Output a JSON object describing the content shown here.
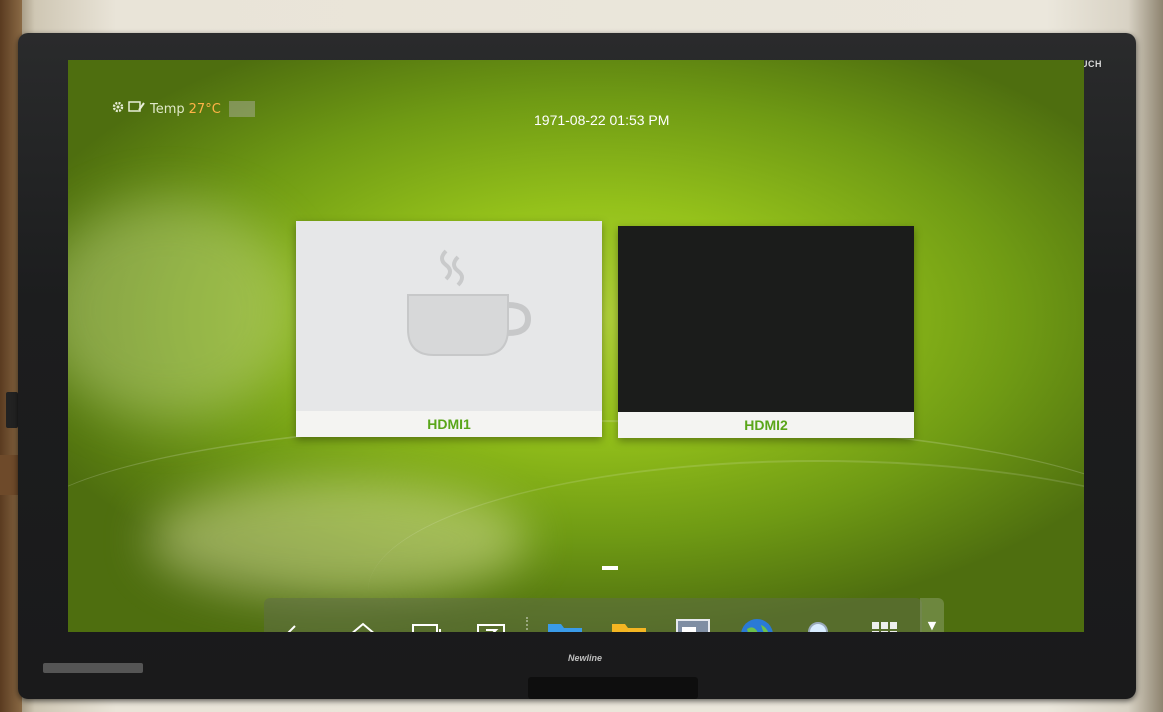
{
  "device": {
    "brand_top": "TRUTOUCH",
    "brand_bottom": "Newline"
  },
  "status_bar": {
    "temp_label": "Temp",
    "temp_value": "27°C"
  },
  "clock": {
    "datetime": "1971-08-22 01:53 PM"
  },
  "sources": [
    {
      "label": "HDMI1",
      "preview": "coffee-cup-idle"
    },
    {
      "label": "HDMI2",
      "preview": "black-signal"
    }
  ],
  "pager": {
    "current_page": 1,
    "total_pages": 1
  },
  "dock": {
    "items": [
      {
        "name": "back",
        "icon": "back-arrow-icon"
      },
      {
        "name": "home",
        "icon": "home-icon"
      },
      {
        "name": "recent-apps",
        "icon": "window-icon"
      },
      {
        "name": "z-note",
        "icon": "z-icon"
      },
      {
        "name": "files",
        "icon": "folder-icon"
      },
      {
        "name": "usb",
        "icon": "usb-folder-icon"
      },
      {
        "name": "settings",
        "icon": "settings-panel-icon"
      },
      {
        "name": "browser",
        "icon": "globe-icon"
      },
      {
        "name": "search",
        "icon": "search-icon"
      },
      {
        "name": "all-apps",
        "icon": "grid-icon"
      }
    ],
    "expand": {
      "icon": "triangle-down-icon"
    }
  },
  "colors": {
    "accent_green": "#5aa61a",
    "wallpaper_green": "#95c21b",
    "temp_orange": "#ffb347"
  }
}
